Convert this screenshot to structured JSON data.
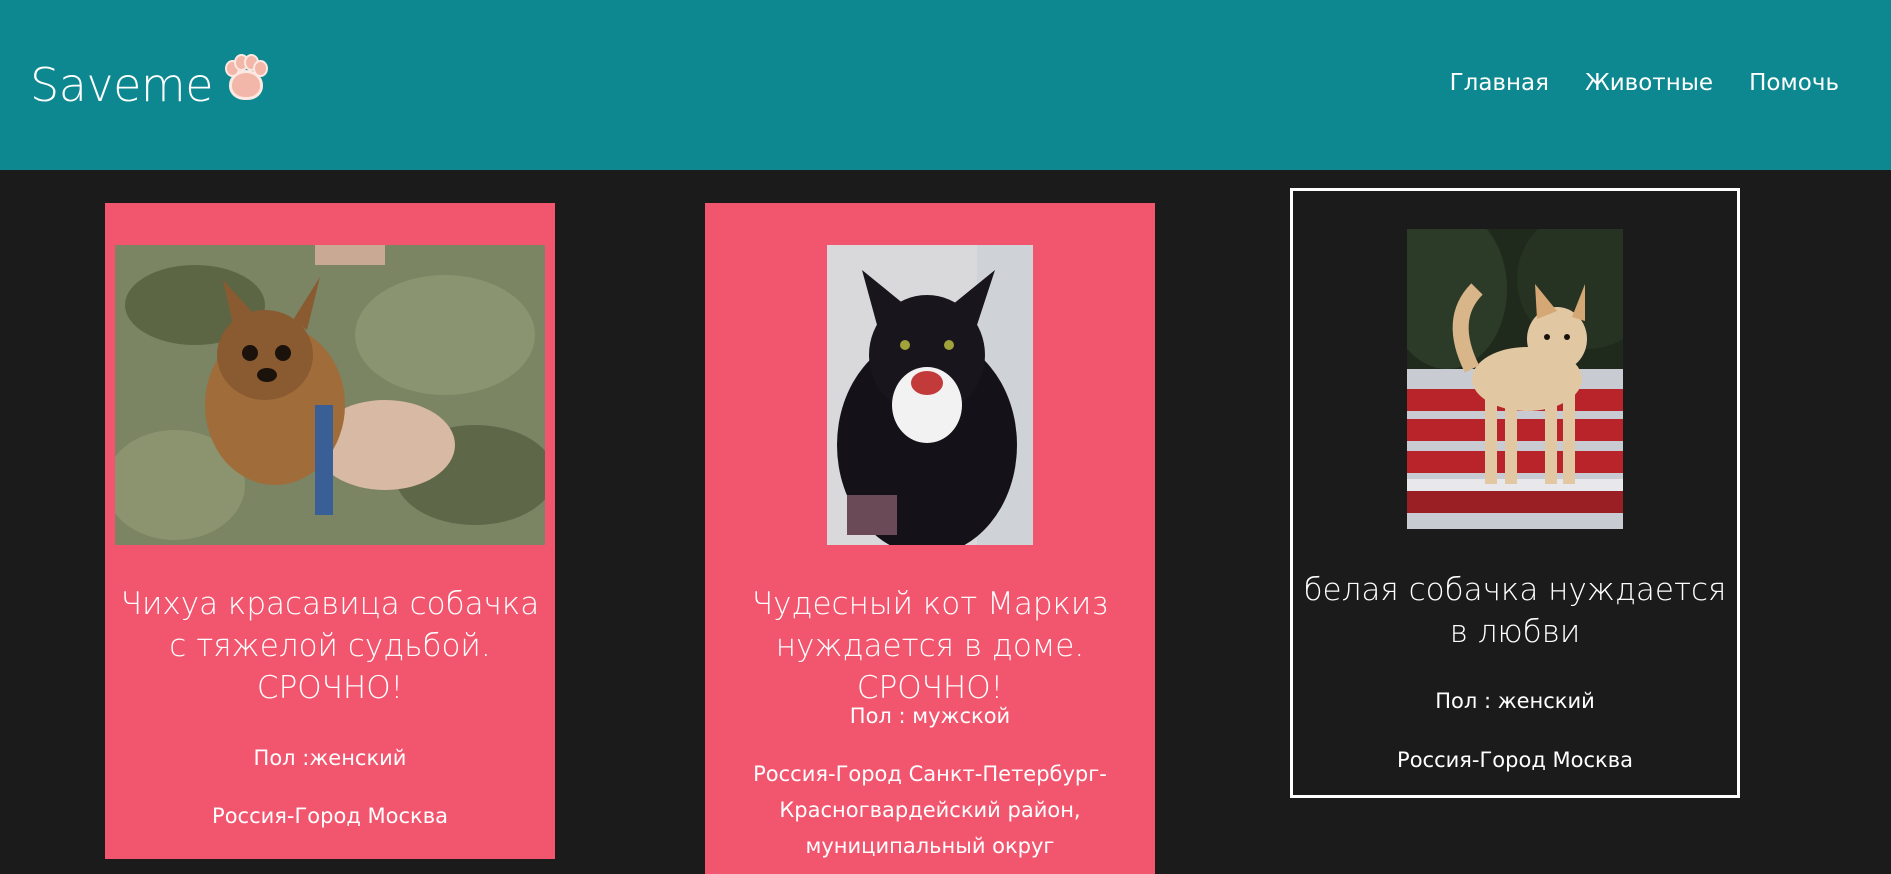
{
  "header": {
    "brand": "Saveme",
    "nav": [
      "Главная",
      "Животные",
      "Помочь"
    ]
  },
  "cards": [
    {
      "title": "Чихуа красавица собачка с тяжелой судьбой. СРОЧНО!",
      "sex": "Пол :женский",
      "location": "Россия-Город Москва",
      "photo": "chihuahua-photo"
    },
    {
      "title": "Чудесный кот Маркиз нуждается в доме. СРОЧНО!",
      "sex": "Пол : мужской",
      "location": "Россия-Город Санкт-Петербург-Красногвардейский район, муниципальный округ",
      "photo": "cat-photo"
    },
    {
      "title": "белая собачка нуждается в любви",
      "sex": "Пол : женский",
      "location": "Россия-Город Москва",
      "photo": "white-dog-photo"
    }
  ],
  "colors": {
    "header": "#0d8890",
    "background": "#1b1b1b",
    "card_pink": "#f2566f",
    "text": "#ffffff"
  }
}
